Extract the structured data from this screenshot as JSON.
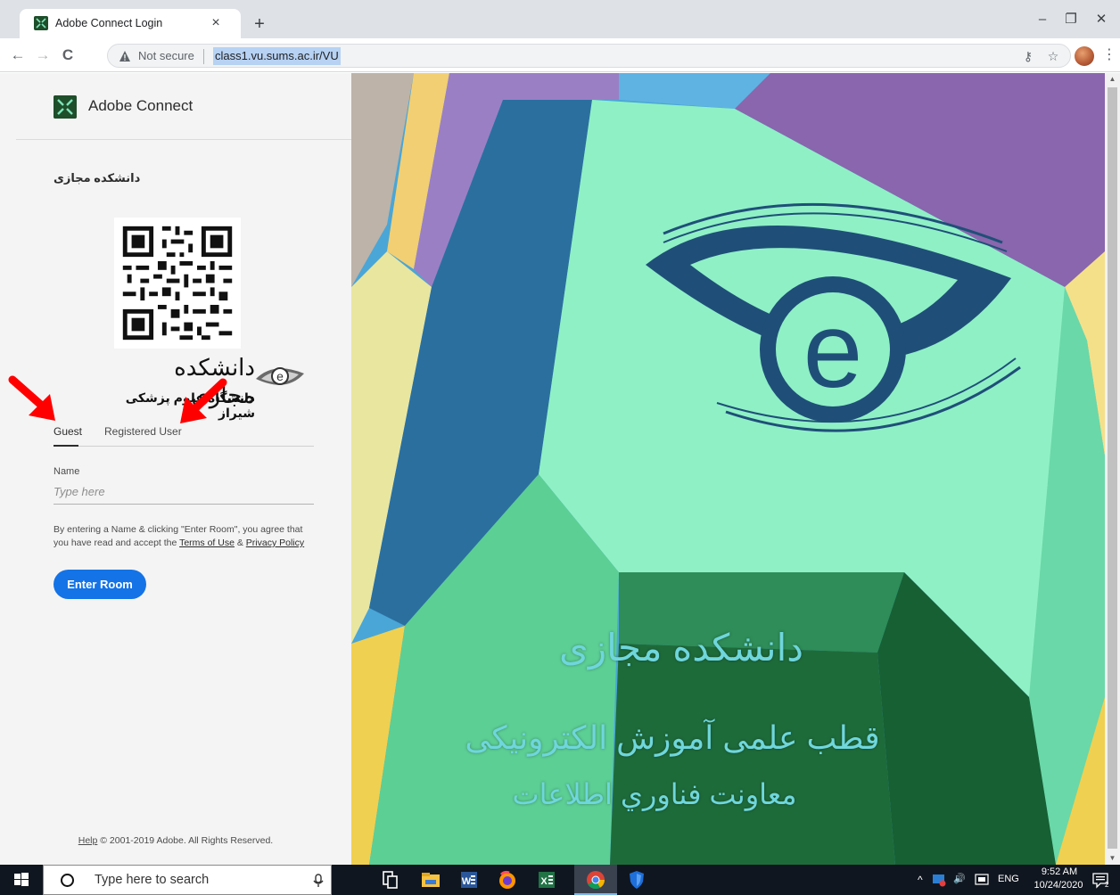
{
  "browser": {
    "tab_title": "Adobe Connect Login",
    "tab_close": "×",
    "new_tab": "+",
    "security_label": "Not secure",
    "url": "class1.vu.sums.ac.ir/VU",
    "window_controls": {
      "minimize": "–",
      "restore": "❐",
      "close": "✕"
    },
    "nav": {
      "back": "←",
      "forward": "→",
      "reload": "C"
    },
    "icons": [
      "key-icon",
      "star-icon",
      "profile-avatar",
      "menu-icon"
    ]
  },
  "login": {
    "brand": "Adobe Connect",
    "org_name": "دانشکده مجازی",
    "logo_title": "دانشکده مجازی",
    "logo_subtitle": "دانشگاه علوم پزشکی شیراز",
    "tabs": {
      "guest": "Guest",
      "registered": "Registered User"
    },
    "active_tab": "Guest",
    "name_label": "Name",
    "name_placeholder": "Type here",
    "legal_prefix": "By entering a Name & clicking \"Enter Room\", you agree that you have read and accept the ",
    "terms_link": "Terms of Use",
    "legal_and": " & ",
    "privacy_link": "Privacy Policy",
    "enter_button": "Enter Room",
    "footer_help": "Help",
    "footer_copyright": " © 2001-2019 Adobe. All Rights Reserved."
  },
  "hero": {
    "line1": "دانشکده مجازی",
    "line2": "قطب علمی آموزش الکترونیکی",
    "line3": "معاونت فناوري اطلاعات",
    "colors": {
      "mint": "#7fe3b8",
      "teal_dark": "#1f4f78",
      "purple": "#8a6cb0",
      "blue": "#3b8fbf",
      "green_dark": "#1e6b3a",
      "yellow": "#f0d050"
    }
  },
  "taskbar": {
    "search_placeholder": "Type here to search",
    "apps": [
      "start-icon",
      "task-view-icon",
      "file-explorer-icon",
      "word-icon",
      "firefox-icon",
      "excel-icon",
      "chrome-icon",
      "defender-icon"
    ],
    "tray": {
      "chevron": "^",
      "volume": "🔊",
      "language": "ENG",
      "time": "9:52 AM",
      "date": "10/24/2020",
      "notifications": "2"
    }
  },
  "annotations": {
    "arrow_color": "#ff0000"
  }
}
